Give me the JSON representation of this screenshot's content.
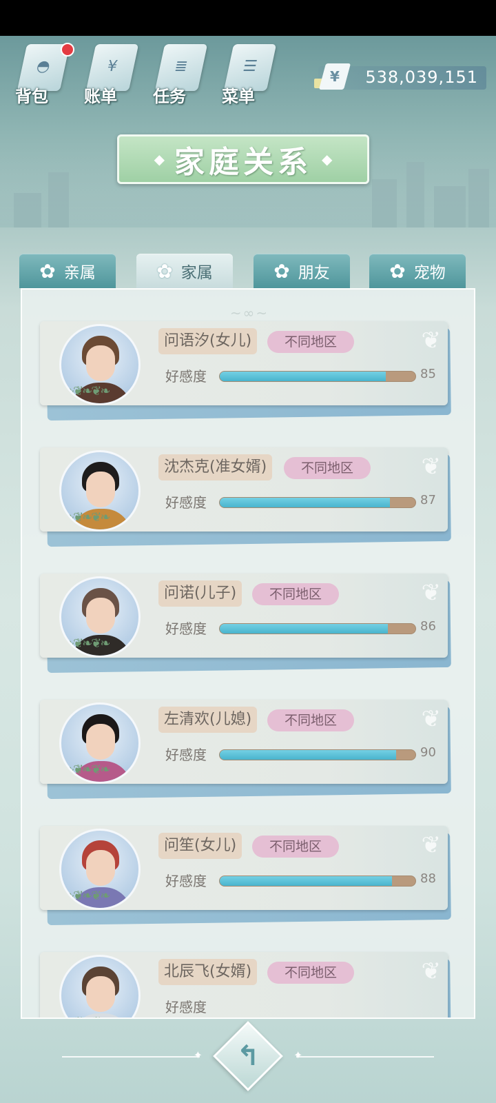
{
  "top_menu": [
    {
      "label": "背包",
      "icon": "bag-icon",
      "glyph": "◓",
      "badge": true
    },
    {
      "label": "账单",
      "icon": "bill-icon",
      "glyph": "¥",
      "badge": false
    },
    {
      "label": "任务",
      "icon": "task-icon",
      "glyph": "≣",
      "badge": false
    },
    {
      "label": "菜单",
      "icon": "menu-icon",
      "glyph": "☰",
      "badge": false
    }
  ],
  "currency": {
    "symbol": "¥",
    "amount": "538,039,151"
  },
  "title": "家庭关系",
  "tabs": [
    {
      "label": "亲属",
      "active": false
    },
    {
      "label": "家属",
      "active": true
    },
    {
      "label": "朋友",
      "active": false
    },
    {
      "label": "宠物",
      "active": false
    }
  ],
  "favor_label": "好感度",
  "members": [
    {
      "name": "问语汐(女儿)",
      "region": "不同地区",
      "favor": 85,
      "hair": "#6b4a34",
      "body": "#5a3b30",
      "name_width": 150
    },
    {
      "name": "沈杰克(准女婿)",
      "region": "不同地区",
      "favor": 87,
      "hair": "#1e1c1c",
      "body": "#c58a3c",
      "name_width": 174
    },
    {
      "name": "问诺(儿子)",
      "region": "不同地区",
      "favor": 86,
      "hair": "#6a5246",
      "body": "#2f2b28",
      "name_width": 128
    },
    {
      "name": "左清欢(儿媳)",
      "region": "不同地区",
      "favor": 90,
      "hair": "#1b1818",
      "body": "#b65a8a",
      "name_width": 150
    },
    {
      "name": "问笙(女儿)",
      "region": "不同地区",
      "favor": 88,
      "hair": "#b5433a",
      "body": "#7a78b3",
      "name_width": 128
    },
    {
      "name": "北辰飞(女婿)",
      "region": "不同地区",
      "favor": null,
      "hair": "#5b4334",
      "body": "#d7dde2",
      "name_width": 150
    }
  ]
}
